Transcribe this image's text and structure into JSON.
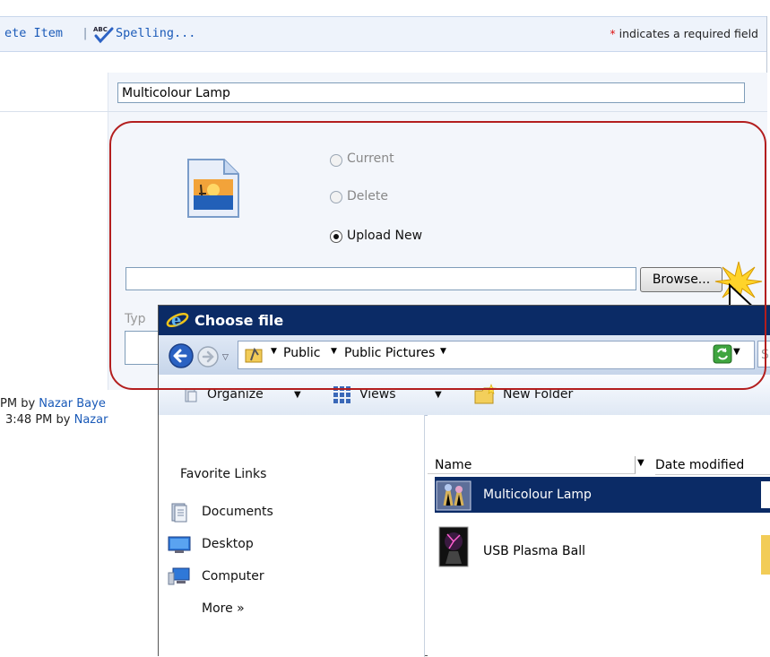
{
  "toolbar": {
    "delete_item": "ete Item",
    "separator": "|",
    "spelling": "Spelling...",
    "required_star": "*",
    "required_note": "indicates a required field"
  },
  "form": {
    "title_value": "Multicolour Lamp",
    "radio_current": "Current",
    "radio_delete": "Delete",
    "radio_upload": "Upload New",
    "radio_selected": "Upload New",
    "browse_label": "Browse...",
    "type_fragment": "Typ",
    "version1_prefix": "PM  by",
    "version1_user": "Nazar Baye",
    "version2_prefix": "3:48 PM  by",
    "version2_user": "Nazar"
  },
  "dialog": {
    "title": "Choose file",
    "breadcrumb": [
      "Public",
      "Public Pictures"
    ],
    "search_fragment": "S",
    "organize": "Organize",
    "views": "Views",
    "new_folder": "New Folder",
    "favorite_links_title": "Favorite Links",
    "favorite_links": [
      "Documents",
      "Desktop",
      "Computer"
    ],
    "more": "More  »",
    "columns": {
      "name": "Name",
      "date": "Date modified"
    },
    "files": [
      "Multicolour Lamp",
      "USB Plasma Ball"
    ],
    "selected_file": "Multicolour Lamp"
  },
  "colors": {
    "accent_link": "#1a5ab8",
    "highlight_border": "#b31e1e",
    "dialog_title_bg": "#0b2b66"
  }
}
